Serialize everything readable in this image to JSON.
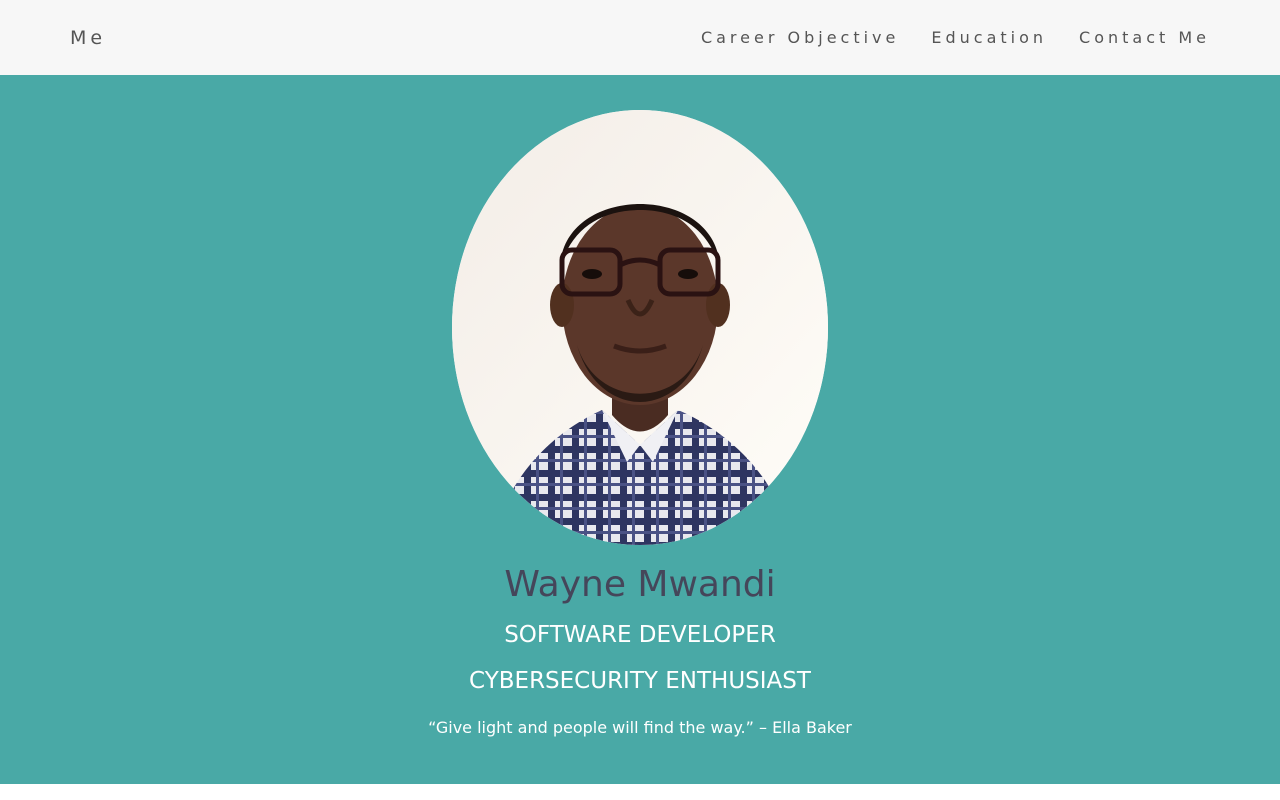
{
  "nav": {
    "brand": "Me",
    "links": [
      "Career Objective",
      "Education",
      "Contact Me"
    ]
  },
  "hero": {
    "portrait_icon": "portrait-photo",
    "name": "Wayne Mwandi",
    "title_1": "SOFTWARE DEVELOPER",
    "title_2": "CYBERSECURITY ENTHUSIAST",
    "quote": "“Give light and people will find the way.” – Ella Baker"
  },
  "colors": {
    "navbar_bg": "#f7f7f7",
    "hero_bg": "#49a9a6",
    "name_text": "#45465a",
    "hero_text": "#ffffff"
  }
}
